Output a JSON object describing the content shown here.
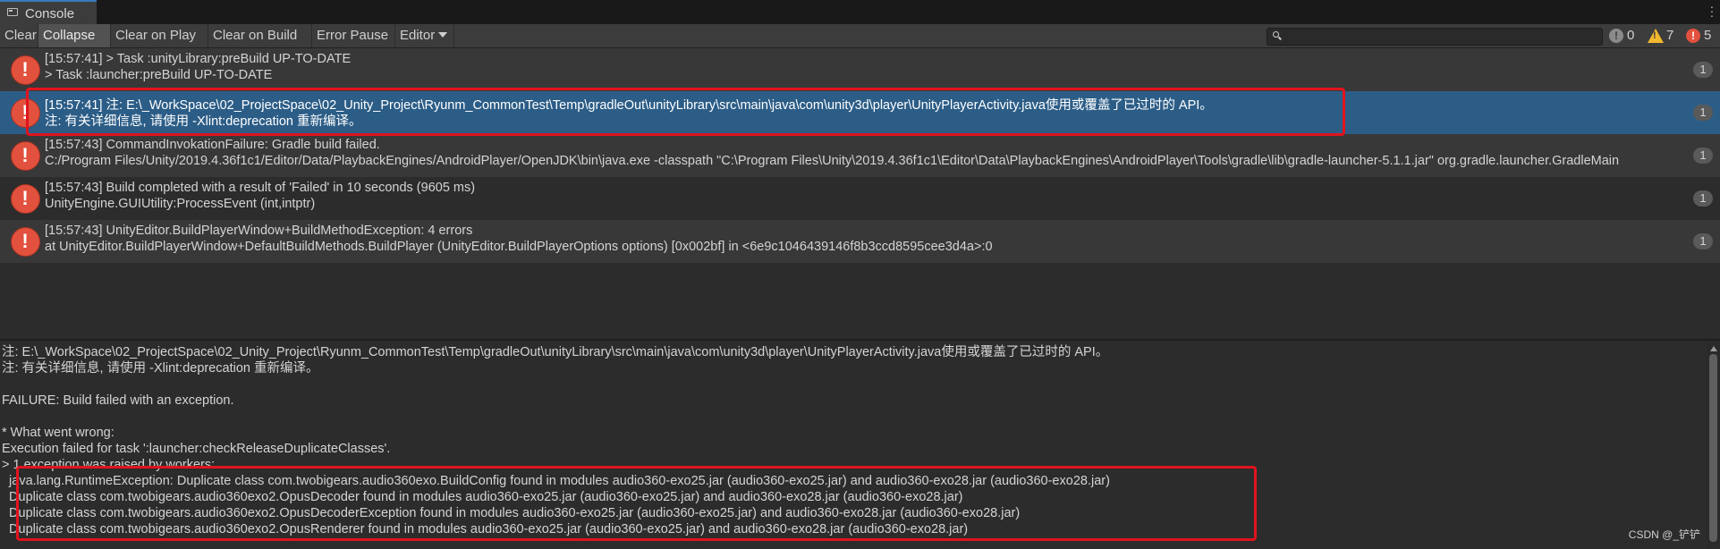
{
  "window": {
    "tab_title": "Console"
  },
  "toolbar": {
    "clear": "Clear",
    "collapse": "Collapse",
    "clear_on_play": "Clear on Play",
    "clear_on_build": "Clear on Build",
    "error_pause": "Error Pause",
    "editor": "Editor"
  },
  "search": {
    "value": ""
  },
  "counts": {
    "info": "0",
    "warnings": "7",
    "errors": "5"
  },
  "colors": {
    "selection": "#2c5d87",
    "error": "#e1513d",
    "warning": "#f2b82e",
    "highlight": "#e0141e"
  },
  "entries": [
    {
      "line1": "[15:57:41] > Task :unityLibrary:preBuild UP-TO-DATE",
      "line2": "> Task :launcher:preBuild UP-TO-DATE",
      "count": "1"
    },
    {
      "line1": "[15:57:41] 注: E:\\_WorkSpace\\02_ProjectSpace\\02_Unity_Project\\Ryunm_CommonTest\\Temp\\gradleOut\\unityLibrary\\src\\main\\java\\com\\unity3d\\player\\UnityPlayerActivity.java使用或覆盖了已过时的 API。",
      "line2": "注: 有关详细信息, 请使用 -Xlint:deprecation 重新编译。",
      "count": "1"
    },
    {
      "line1": "[15:57:43] CommandInvokationFailure: Gradle build failed.",
      "line2": "C:/Program Files/Unity/2019.4.36f1c1/Editor/Data/PlaybackEngines/AndroidPlayer/OpenJDK\\bin\\java.exe -classpath \"C:\\Program Files\\Unity\\2019.4.36f1c1\\Editor\\Data\\PlaybackEngines\\AndroidPlayer\\Tools\\gradle\\lib\\gradle-launcher-5.1.1.jar\" org.gradle.launcher.GradleMain",
      "count": "1"
    },
    {
      "line1": "[15:57:43] Build completed with a result of 'Failed' in 10 seconds (9605 ms)",
      "line2": "UnityEngine.GUIUtility:ProcessEvent (int,intptr)",
      "count": "1"
    },
    {
      "line1": "[15:57:43] UnityEditor.BuildPlayerWindow+BuildMethodException: 4 errors",
      "line2": " at UnityEditor.BuildPlayerWindow+DefaultBuildMethods.BuildPlayer (UnityEditor.BuildPlayerOptions options) [0x002bf] in <6e9c1046439146f8b3ccd8595cee3d4a>:0",
      "count": "1"
    }
  ],
  "detail": {
    "lines": [
      "注: E:\\_WorkSpace\\02_ProjectSpace\\02_Unity_Project\\Ryunm_CommonTest\\Temp\\gradleOut\\unityLibrary\\src\\main\\java\\com\\unity3d\\player\\UnityPlayerActivity.java使用或覆盖了已过时的 API。",
      "注: 有关详细信息, 请使用 -Xlint:deprecation 重新编译。",
      "",
      "FAILURE: Build failed with an exception.",
      "",
      "* What went wrong:",
      "Execution failed for task ':launcher:checkReleaseDuplicateClasses'.",
      "> 1 exception was raised by workers:",
      "  java.lang.RuntimeException: Duplicate class com.twobigears.audio360exo.BuildConfig found in modules audio360-exo25.jar (audio360-exo25.jar) and audio360-exo28.jar (audio360-exo28.jar)",
      "  Duplicate class com.twobigears.audio360exo2.OpusDecoder found in modules audio360-exo25.jar (audio360-exo25.jar) and audio360-exo28.jar (audio360-exo28.jar)",
      "  Duplicate class com.twobigears.audio360exo2.OpusDecoderException found in modules audio360-exo25.jar (audio360-exo25.jar) and audio360-exo28.jar (audio360-exo28.jar)",
      "  Duplicate class com.twobigears.audio360exo2.OpusRenderer found in modules audio360-exo25.jar (audio360-exo25.jar) and audio360-exo28.jar (audio360-exo28.jar)"
    ]
  },
  "watermark": "CSDN @_铲铲"
}
